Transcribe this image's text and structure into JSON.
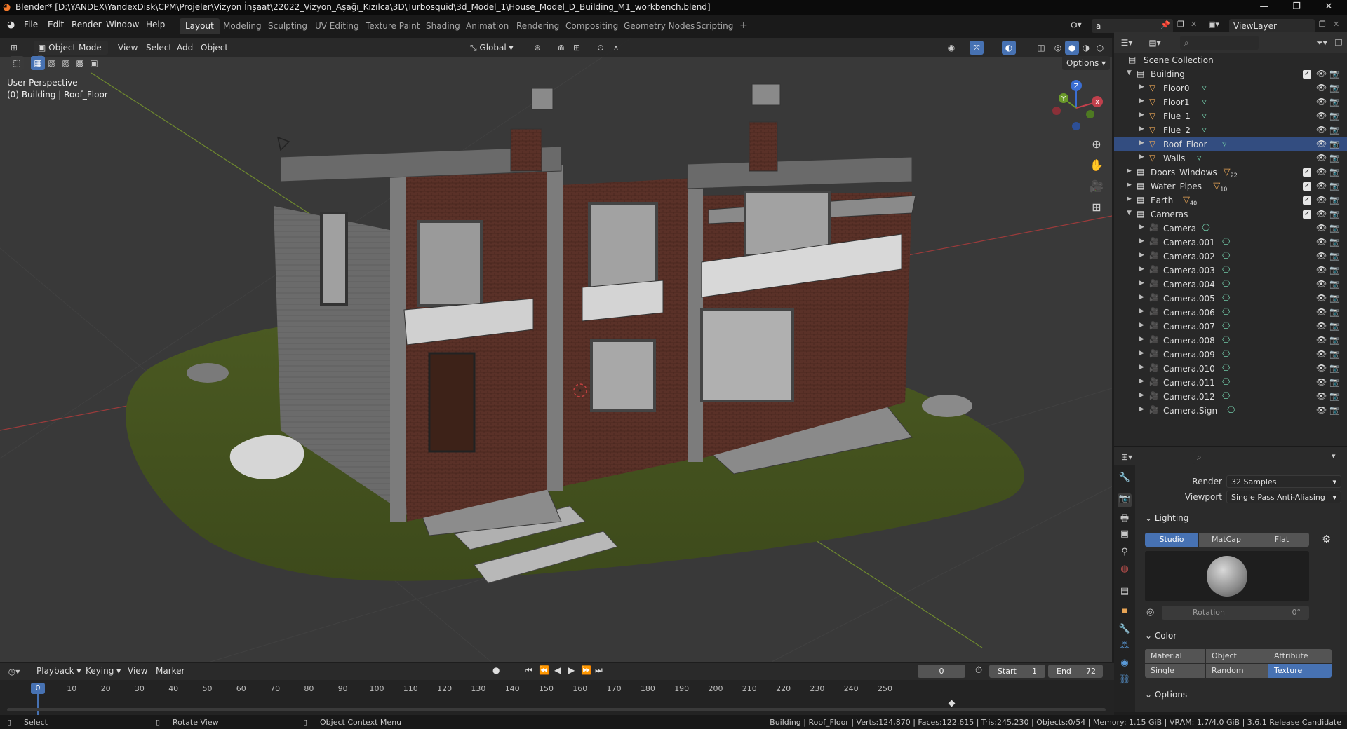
{
  "window": {
    "title": "Blender* [D:\\YANDEX\\YandexDisk\\CPM\\Projeler\\Vizyon İnşaat\\22022_Vizyon_Aşağı_Kızılca\\3D\\Turbosquid\\3d_Model_1\\House_Model_D_Building_M1_workbench.blend]"
  },
  "menu": [
    "File",
    "Edit",
    "Render",
    "Window",
    "Help"
  ],
  "workspaces": [
    "Layout",
    "Modeling",
    "Sculpting",
    "UV Editing",
    "Texture Paint",
    "Shading",
    "Animation",
    "Rendering",
    "Compositing",
    "Geometry Nodes",
    "Scripting"
  ],
  "active_workspace": "Layout",
  "scene_field": "a",
  "view_layer": "ViewLayer",
  "viewport_header": {
    "mode": "Object Mode",
    "menus": [
      "View",
      "Select",
      "Add",
      "Object"
    ],
    "orientation": "Global",
    "options": "Options"
  },
  "viewport_info": {
    "perspective": "User Perspective",
    "context": "(0) Building | Roof_Floor"
  },
  "gizmo": {
    "x": "X",
    "y": "Y",
    "z": "Z"
  },
  "outliner": {
    "root": "Scene Collection",
    "rows": [
      {
        "label": "Building",
        "kind": "collection",
        "level": 0,
        "expanded": true,
        "checkbox": true
      },
      {
        "label": "Floor0",
        "kind": "mesh",
        "level": 1
      },
      {
        "label": "Floor1",
        "kind": "mesh",
        "level": 1
      },
      {
        "label": "Flue_1",
        "kind": "mesh",
        "level": 1
      },
      {
        "label": "Flue_2",
        "kind": "mesh",
        "level": 1
      },
      {
        "label": "Roof_Floor",
        "kind": "mesh",
        "level": 1,
        "selected": true
      },
      {
        "label": "Walls",
        "kind": "mesh",
        "level": 1
      },
      {
        "label": "Doors_Windows",
        "kind": "collection",
        "level": 0,
        "expanded": false,
        "checkbox": true,
        "badge": "22"
      },
      {
        "label": "Water_Pipes",
        "kind": "collection",
        "level": 0,
        "expanded": false,
        "checkbox": true,
        "badge": "10"
      },
      {
        "label": "Earth",
        "kind": "collection",
        "level": 0,
        "expanded": false,
        "checkbox": true,
        "badge": "40"
      },
      {
        "label": "Cameras",
        "kind": "collection",
        "level": 0,
        "expanded": true,
        "checkbox": true
      },
      {
        "label": "Camera",
        "kind": "camera",
        "level": 1
      },
      {
        "label": "Camera.001",
        "kind": "camera",
        "level": 1
      },
      {
        "label": "Camera.002",
        "kind": "camera",
        "level": 1
      },
      {
        "label": "Camera.003",
        "kind": "camera",
        "level": 1
      },
      {
        "label": "Camera.004",
        "kind": "camera",
        "level": 1
      },
      {
        "label": "Camera.005",
        "kind": "camera",
        "level": 1
      },
      {
        "label": "Camera.006",
        "kind": "camera",
        "level": 1
      },
      {
        "label": "Camera.007",
        "kind": "camera",
        "level": 1
      },
      {
        "label": "Camera.008",
        "kind": "camera",
        "level": 1
      },
      {
        "label": "Camera.009",
        "kind": "camera",
        "level": 1
      },
      {
        "label": "Camera.010",
        "kind": "camera",
        "level": 1
      },
      {
        "label": "Camera.011",
        "kind": "camera",
        "level": 1
      },
      {
        "label": "Camera.012",
        "kind": "camera",
        "level": 1
      },
      {
        "label": "Camera.Sign",
        "kind": "camera",
        "level": 1
      }
    ]
  },
  "properties": {
    "render_label": "Render",
    "render_value": "32 Samples",
    "viewport_label": "Viewport",
    "viewport_value": "Single Pass Anti-Aliasing",
    "lighting_title": "Lighting",
    "lighting_modes": [
      "Studio",
      "MatCap",
      "Flat"
    ],
    "lighting_active": "Studio",
    "rotation_label": "Rotation",
    "rotation_value": "0°",
    "color_title": "Color",
    "color_modes": [
      "Material",
      "Object",
      "Attribute",
      "Single",
      "Random",
      "Texture"
    ],
    "color_active": "Texture",
    "options_title": "Options"
  },
  "timeline": {
    "menus": [
      "Playback",
      "Keying",
      "View",
      "Marker"
    ],
    "current_frame": "0",
    "start_label": "Start",
    "start_value": "1",
    "end_label": "End",
    "end_value": "72",
    "ticks": [
      "0",
      "10",
      "20",
      "30",
      "40",
      "50",
      "60",
      "70",
      "80",
      "90",
      "100",
      "110",
      "120",
      "130",
      "140",
      "150",
      "160",
      "170",
      "180",
      "190",
      "200",
      "210",
      "220",
      "230",
      "240",
      "250"
    ]
  },
  "status": {
    "select": "Select",
    "rotate": "Rotate View",
    "context_menu": "Object Context Menu",
    "stats": "Building | Roof_Floor | Verts:124,870 | Faces:122,615 | Tris:245,230 | Objects:0/54 | Memory: 1.15 GiB | VRAM: 1.7/4.0 GiB | 3.6.1 Release Candidate"
  },
  "colors": {
    "accent": "#4772b3",
    "selection": "#334d80",
    "mesh_icon": "#e7a455",
    "camera_icon": "#e7a455",
    "data_icon": "#6fc6a5"
  }
}
